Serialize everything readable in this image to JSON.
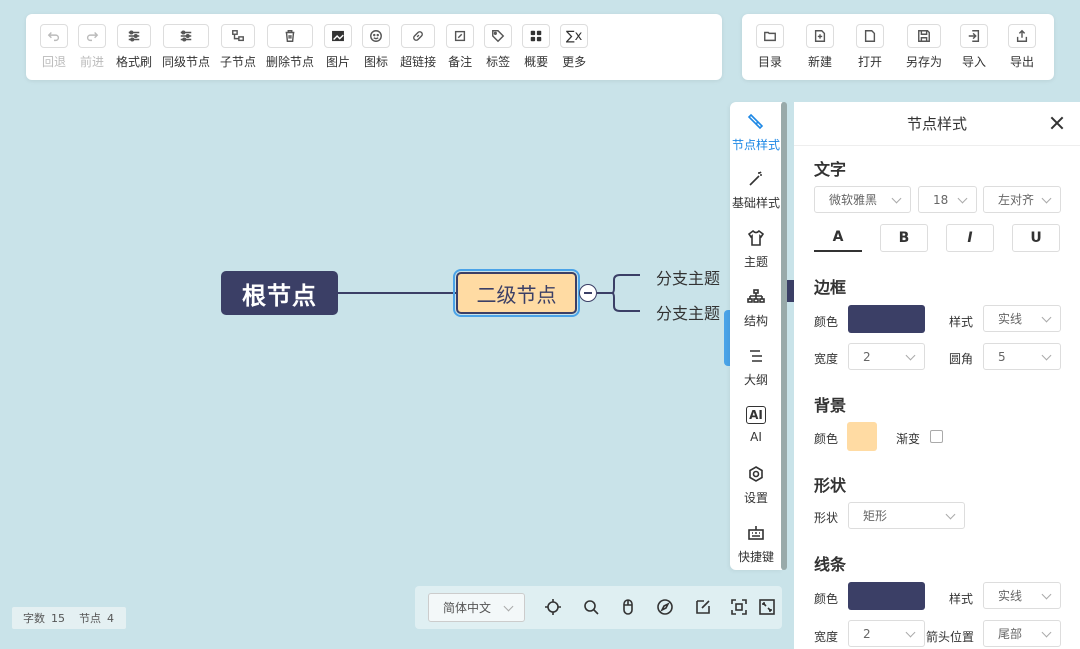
{
  "toolbar_left": [
    {
      "id": "undo",
      "label": "回退",
      "icon": "undo-icon",
      "disabled": true
    },
    {
      "id": "redo",
      "label": "前进",
      "icon": "redo-icon",
      "disabled": true
    },
    {
      "id": "format-painter",
      "label": "格式刷",
      "icon": "sliders-icon"
    },
    {
      "id": "sibling-node",
      "label": "同级节点",
      "icon": "sliders-icon"
    },
    {
      "id": "child-node",
      "label": "子节点",
      "icon": "child-node-icon"
    },
    {
      "id": "delete-node",
      "label": "删除节点",
      "icon": "trash-icon"
    },
    {
      "id": "image",
      "label": "图片",
      "icon": "image-icon"
    },
    {
      "id": "icon",
      "label": "图标",
      "icon": "smiley-icon"
    },
    {
      "id": "hyperlink",
      "label": "超链接",
      "icon": "link-icon"
    },
    {
      "id": "note",
      "label": "备注",
      "icon": "note-icon"
    },
    {
      "id": "tag",
      "label": "标签",
      "icon": "tag-icon"
    },
    {
      "id": "summary",
      "label": "概要",
      "icon": "grid-icon"
    },
    {
      "id": "more",
      "label": "更多",
      "icon": "formula-icon"
    }
  ],
  "toolbar_right": [
    {
      "id": "directory",
      "label": "目录",
      "icon": "folder-icon"
    },
    {
      "id": "new",
      "label": "新建",
      "icon": "new-file-icon"
    },
    {
      "id": "open",
      "label": "打开",
      "icon": "file-icon"
    },
    {
      "id": "save-as",
      "label": "另存为",
      "icon": "save-icon"
    },
    {
      "id": "import",
      "label": "导入",
      "icon": "import-icon"
    },
    {
      "id": "export",
      "label": "导出",
      "icon": "export-icon"
    }
  ],
  "mindmap": {
    "root": "根节点",
    "second": "二级节点",
    "branches": [
      "分支主题",
      "分支主题"
    ]
  },
  "side_tabs": [
    {
      "label": "节点样式",
      "icon": "node-style-icon",
      "active": true
    },
    {
      "label": "基础样式",
      "icon": "magic-wand-icon"
    },
    {
      "label": "主题",
      "icon": "shirt-icon"
    },
    {
      "label": "结构",
      "icon": "structure-icon"
    },
    {
      "label": "大纲",
      "icon": "outline-icon"
    },
    {
      "label": "AI",
      "icon": "ai-icon"
    },
    {
      "label": "设置",
      "icon": "settings-icon"
    },
    {
      "label": "快捷键",
      "icon": "keyboard-icon"
    }
  ],
  "panel": {
    "title": "节点样式",
    "text_section": "文字",
    "font_family": "微软雅黑",
    "font_size": "18",
    "align": "左对齐",
    "font_buttons": [
      "A",
      "B",
      "I",
      "U"
    ],
    "border_section": "边框",
    "color_label": "颜色",
    "style_label": "样式",
    "border_style": "实线",
    "width_label": "宽度",
    "border_width": "2",
    "radius_label": "圆角",
    "border_radius": "5",
    "border_color": "#3b3f66",
    "bg_section": "背景",
    "bg_color_label": "颜色",
    "bg_color": "#ffdba3",
    "gradient_label": "渐变",
    "shape_section": "形状",
    "shape_label": "形状",
    "shape_value": "矩形",
    "line_section": "线条",
    "line_color_label": "颜色",
    "line_color": "#3b3f66",
    "line_style_label": "样式",
    "line_style": "实线",
    "line_width_label": "宽度",
    "line_width": "2",
    "arrow_label": "箭头位置",
    "arrow_value": "尾部"
  },
  "bottom": {
    "language": "简体中文",
    "icons": [
      "locate-icon",
      "search-icon",
      "mouse-icon",
      "compass-icon",
      "edit-icon",
      "fit-icon",
      "fullscreen-icon"
    ]
  },
  "stats": {
    "words_label": "字数",
    "words": "15",
    "nodes_label": "节点",
    "nodes": "4"
  }
}
